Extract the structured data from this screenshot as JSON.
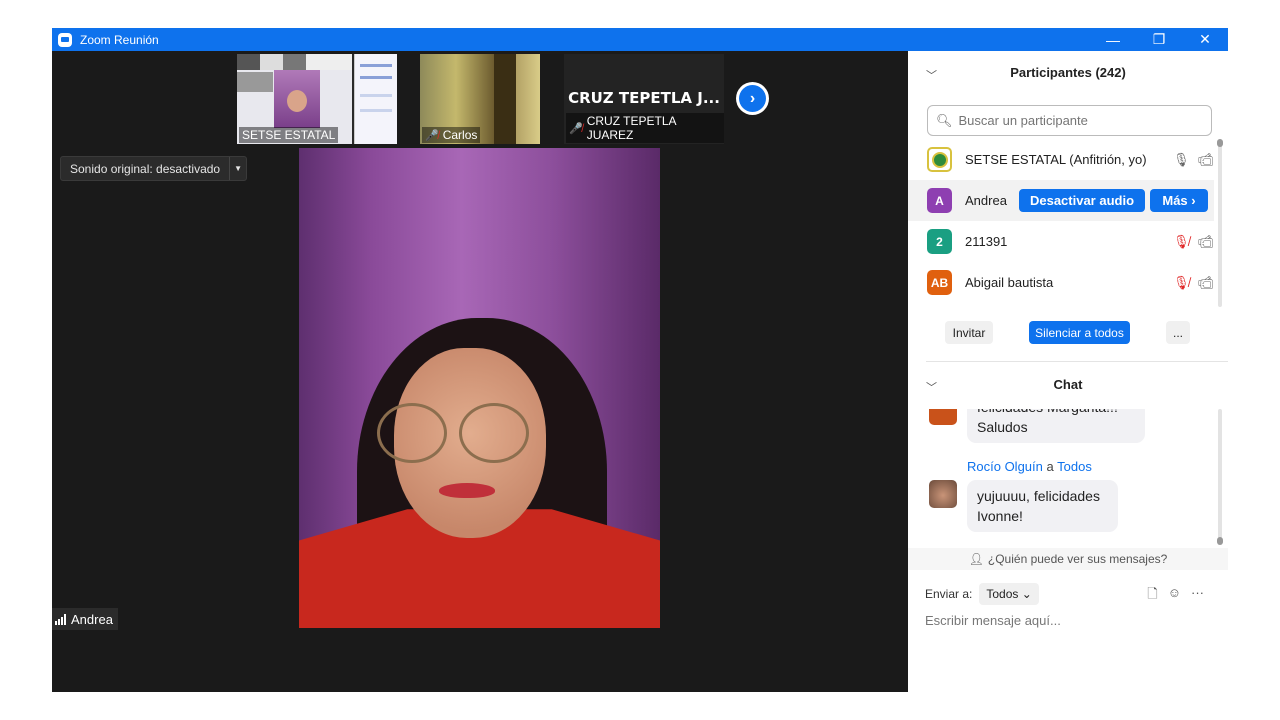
{
  "window": {
    "title": "Zoom Reunión",
    "controls": [
      "—",
      "❐",
      "✕"
    ]
  },
  "thumbnails": [
    {
      "name": "SETSE ESTATAL",
      "muted": false
    },
    {
      "name": "Carlos",
      "muted": true
    },
    {
      "name": "CRUZ TEPETLA JUAREZ",
      "muted": true,
      "display_name": "CRUZ TEPETLA J..."
    }
  ],
  "sound_toggle": {
    "label": "Sonido original: desactivado"
  },
  "active_speaker": {
    "name": "Andrea"
  },
  "participants": {
    "header": "Participantes (242)",
    "search_placeholder": "Buscar un participante",
    "rows": [
      {
        "name": "SETSE ESTATAL (Anfitrión, yo)",
        "avatar_text": "",
        "avatar_color": "#d8c23e",
        "audio": "on"
      },
      {
        "name": "Andrea",
        "avatar_text": "A",
        "avatar_color": "#8e3fb1",
        "unmute_request_label": "Desactivar audio",
        "more_label": "Más ›"
      },
      {
        "name": "211391",
        "avatar_text": "2",
        "avatar_color": "#1a9f82",
        "audio": "muted"
      },
      {
        "name": "Abigail bautista",
        "avatar_text": "AB",
        "avatar_color": "#e0600e",
        "audio": "muted"
      }
    ],
    "footer": {
      "invite": "Invitar",
      "mute_all": "Silenciar a todos",
      "more": "..."
    }
  },
  "chat": {
    "header": "Chat",
    "messages": [
      {
        "sender": "",
        "text_partial": "felicidades Margarita!!!",
        "text": "Saludos"
      },
      {
        "sender": "Rocío Olguín",
        "to_word": "a",
        "to": "Todos",
        "text_line1": "yujuuuu, felicidades",
        "text_line2": "Ivonne!"
      }
    ],
    "who_can_see": "¿Quién puede ver sus mensajes?",
    "send_to_label": "Enviar a:",
    "send_to_value": "Todos",
    "input_placeholder": "Escribir mensaje aquí..."
  },
  "colors": {
    "zoom_blue": "#0e72ed",
    "mute_red": "#e02828"
  }
}
